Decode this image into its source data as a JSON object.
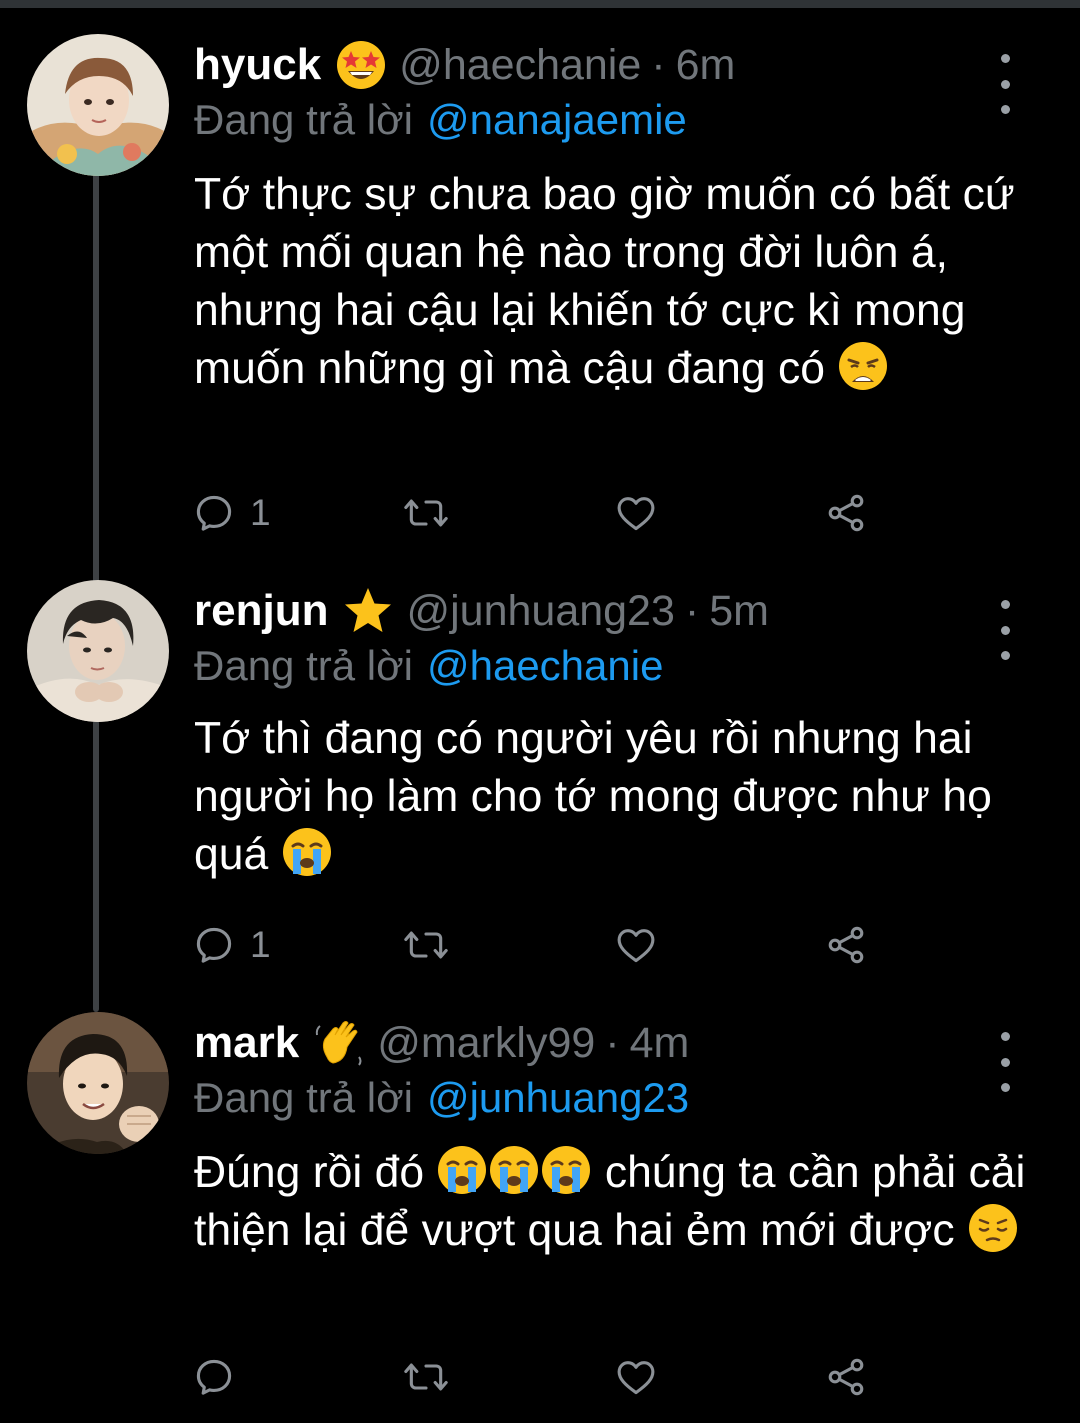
{
  "colors": {
    "background": "#000000",
    "text": "#ffffff",
    "muted": "#71767b",
    "link": "#1d9bf0",
    "thread_line": "#3e4144"
  },
  "replying_label": "Đang trả lời",
  "tweets": [
    {
      "name": "hyuck",
      "badge_emoji": "star-struck-emoji",
      "handle": "@haechanie",
      "separator": "·",
      "time": "6m",
      "reply_to": "@nanajaemie",
      "text": "Tớ thực sự chưa bao giờ muốn có bất cứ một mối quan hệ nào trong đời luôn á, nhưng hai cậu lại khiến tớ cực kì mong muốn những gì mà cậu đang có",
      "text_emoji": "weary-face-emoji",
      "reply_count": "1",
      "avatar_colors": [
        "#d9c7b0",
        "#6b4a32",
        "#f1d8c4"
      ]
    },
    {
      "name": "renjun",
      "badge_emoji": "star-emoji",
      "handle": "@junhuang23",
      "separator": "·",
      "time": "5m",
      "reply_to": "@haechanie",
      "text": "Tớ thì đang có người yêu rồi nhưng hai người họ làm cho tớ mong được như họ quá",
      "text_emoji": "loudly-crying-face-emoji",
      "reply_count": "1",
      "avatar_colors": [
        "#c7b8a8",
        "#2a2622",
        "#e8d2c0"
      ]
    },
    {
      "name": "mark",
      "badge_emoji": "waving-hand-emoji",
      "handle": "@markly99",
      "separator": "·",
      "time": "4m",
      "reply_to": "@junhuang23",
      "text_part1": "Đúng rồi đó",
      "text_part2": "chúng ta cần phải cải thiện lại để vượt qua hai ẻm mới được",
      "inline_emojis": [
        "loudly-crying-face-emoji",
        "loudly-crying-face-emoji",
        "loudly-crying-face-emoji",
        "pensive-face-emoji"
      ],
      "reply_count": "",
      "avatar_colors": [
        "#5a4a3a",
        "#1e1812",
        "#f0d6bc"
      ]
    }
  ],
  "icons": [
    "reply-icon",
    "retweet-icon",
    "like-icon",
    "share-icon",
    "more-icon"
  ]
}
